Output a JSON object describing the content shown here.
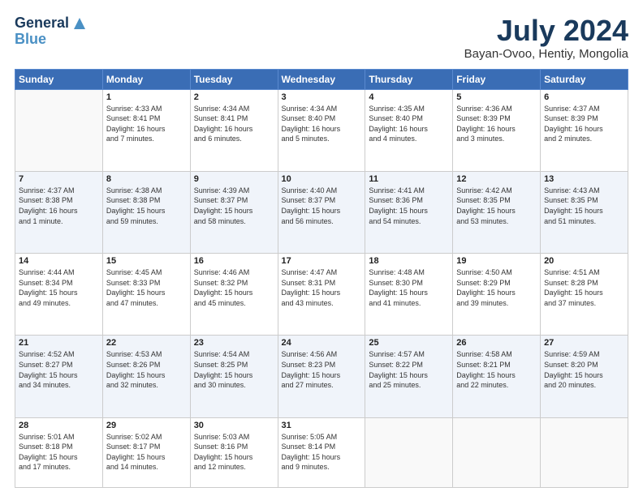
{
  "header": {
    "logo_line1": "General",
    "logo_line2": "Blue",
    "month": "July 2024",
    "location": "Bayan-Ovoo, Hentiy, Mongolia"
  },
  "weekdays": [
    "Sunday",
    "Monday",
    "Tuesday",
    "Wednesday",
    "Thursday",
    "Friday",
    "Saturday"
  ],
  "weeks": [
    [
      {
        "day": "",
        "info": ""
      },
      {
        "day": "1",
        "info": "Sunrise: 4:33 AM\nSunset: 8:41 PM\nDaylight: 16 hours\nand 7 minutes."
      },
      {
        "day": "2",
        "info": "Sunrise: 4:34 AM\nSunset: 8:41 PM\nDaylight: 16 hours\nand 6 minutes."
      },
      {
        "day": "3",
        "info": "Sunrise: 4:34 AM\nSunset: 8:40 PM\nDaylight: 16 hours\nand 5 minutes."
      },
      {
        "day": "4",
        "info": "Sunrise: 4:35 AM\nSunset: 8:40 PM\nDaylight: 16 hours\nand 4 minutes."
      },
      {
        "day": "5",
        "info": "Sunrise: 4:36 AM\nSunset: 8:39 PM\nDaylight: 16 hours\nand 3 minutes."
      },
      {
        "day": "6",
        "info": "Sunrise: 4:37 AM\nSunset: 8:39 PM\nDaylight: 16 hours\nand 2 minutes."
      }
    ],
    [
      {
        "day": "7",
        "info": "Sunrise: 4:37 AM\nSunset: 8:38 PM\nDaylight: 16 hours\nand 1 minute."
      },
      {
        "day": "8",
        "info": "Sunrise: 4:38 AM\nSunset: 8:38 PM\nDaylight: 15 hours\nand 59 minutes."
      },
      {
        "day": "9",
        "info": "Sunrise: 4:39 AM\nSunset: 8:37 PM\nDaylight: 15 hours\nand 58 minutes."
      },
      {
        "day": "10",
        "info": "Sunrise: 4:40 AM\nSunset: 8:37 PM\nDaylight: 15 hours\nand 56 minutes."
      },
      {
        "day": "11",
        "info": "Sunrise: 4:41 AM\nSunset: 8:36 PM\nDaylight: 15 hours\nand 54 minutes."
      },
      {
        "day": "12",
        "info": "Sunrise: 4:42 AM\nSunset: 8:35 PM\nDaylight: 15 hours\nand 53 minutes."
      },
      {
        "day": "13",
        "info": "Sunrise: 4:43 AM\nSunset: 8:35 PM\nDaylight: 15 hours\nand 51 minutes."
      }
    ],
    [
      {
        "day": "14",
        "info": "Sunrise: 4:44 AM\nSunset: 8:34 PM\nDaylight: 15 hours\nand 49 minutes."
      },
      {
        "day": "15",
        "info": "Sunrise: 4:45 AM\nSunset: 8:33 PM\nDaylight: 15 hours\nand 47 minutes."
      },
      {
        "day": "16",
        "info": "Sunrise: 4:46 AM\nSunset: 8:32 PM\nDaylight: 15 hours\nand 45 minutes."
      },
      {
        "day": "17",
        "info": "Sunrise: 4:47 AM\nSunset: 8:31 PM\nDaylight: 15 hours\nand 43 minutes."
      },
      {
        "day": "18",
        "info": "Sunrise: 4:48 AM\nSunset: 8:30 PM\nDaylight: 15 hours\nand 41 minutes."
      },
      {
        "day": "19",
        "info": "Sunrise: 4:50 AM\nSunset: 8:29 PM\nDaylight: 15 hours\nand 39 minutes."
      },
      {
        "day": "20",
        "info": "Sunrise: 4:51 AM\nSunset: 8:28 PM\nDaylight: 15 hours\nand 37 minutes."
      }
    ],
    [
      {
        "day": "21",
        "info": "Sunrise: 4:52 AM\nSunset: 8:27 PM\nDaylight: 15 hours\nand 34 minutes."
      },
      {
        "day": "22",
        "info": "Sunrise: 4:53 AM\nSunset: 8:26 PM\nDaylight: 15 hours\nand 32 minutes."
      },
      {
        "day": "23",
        "info": "Sunrise: 4:54 AM\nSunset: 8:25 PM\nDaylight: 15 hours\nand 30 minutes."
      },
      {
        "day": "24",
        "info": "Sunrise: 4:56 AM\nSunset: 8:23 PM\nDaylight: 15 hours\nand 27 minutes."
      },
      {
        "day": "25",
        "info": "Sunrise: 4:57 AM\nSunset: 8:22 PM\nDaylight: 15 hours\nand 25 minutes."
      },
      {
        "day": "26",
        "info": "Sunrise: 4:58 AM\nSunset: 8:21 PM\nDaylight: 15 hours\nand 22 minutes."
      },
      {
        "day": "27",
        "info": "Sunrise: 4:59 AM\nSunset: 8:20 PM\nDaylight: 15 hours\nand 20 minutes."
      }
    ],
    [
      {
        "day": "28",
        "info": "Sunrise: 5:01 AM\nSunset: 8:18 PM\nDaylight: 15 hours\nand 17 minutes."
      },
      {
        "day": "29",
        "info": "Sunrise: 5:02 AM\nSunset: 8:17 PM\nDaylight: 15 hours\nand 14 minutes."
      },
      {
        "day": "30",
        "info": "Sunrise: 5:03 AM\nSunset: 8:16 PM\nDaylight: 15 hours\nand 12 minutes."
      },
      {
        "day": "31",
        "info": "Sunrise: 5:05 AM\nSunset: 8:14 PM\nDaylight: 15 hours\nand 9 minutes."
      },
      {
        "day": "",
        "info": ""
      },
      {
        "day": "",
        "info": ""
      },
      {
        "day": "",
        "info": ""
      }
    ]
  ]
}
